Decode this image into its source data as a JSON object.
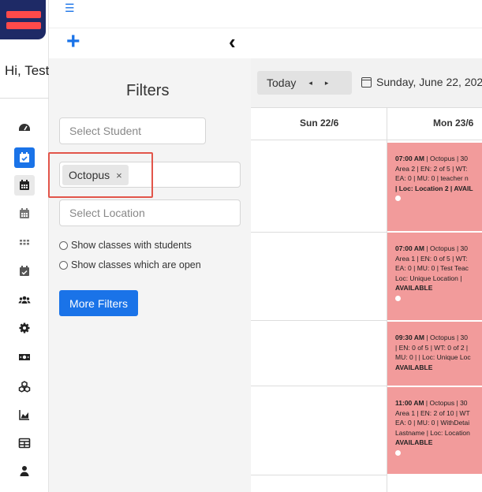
{
  "user": {
    "greeting": "Hi, Test"
  },
  "filters": {
    "title": "Filters",
    "student_placeholder": "Select Student",
    "selected_tag": "Octopus",
    "tag_remove": "×",
    "location_placeholder": "Select Location",
    "option_with_students": "Show classes with students",
    "option_open": "Show classes which are open",
    "more_filters": "More Filters"
  },
  "calendar": {
    "today_label": "Today",
    "prev": "◂",
    "next": "▸",
    "date": "Sunday, June 22, 202",
    "days": [
      "Sun 22/6",
      "Mon 23/6"
    ],
    "events": [
      {
        "time": "07:00 AM",
        "lines": [
          "| Octopus | 30",
          "Area 2 | EN: 2 of 5 | WT:",
          "EA: 0 | MU: 0 | teacher n",
          "| Loc: Location 2 | AVAIL"
        ]
      },
      {
        "time": "07:00 AM",
        "lines": [
          "| Octopus | 30",
          "Area 1 | EN: 0 of 5 | WT:",
          "EA: 0 | MU: 0 | Test Teac",
          "Loc: Unique Location |"
        ],
        "status": "AVAILABLE"
      },
      {
        "time": "09:30 AM",
        "lines": [
          "| Octopus | 30",
          "| EN: 0 of 5 | WT: 0 of 2 |",
          "MU: 0 | | Loc: Unique Loc"
        ],
        "status": "AVAILABLE"
      },
      {
        "time": "11:00 AM",
        "lines": [
          "| Octopus | 30",
          "Area 1 | EN: 2 of 10 | WT",
          "EA: 0 | MU: 0 | WithDetai",
          "Lastname | Loc: Location"
        ],
        "status": "AVAILABLE"
      }
    ]
  },
  "colors": {
    "accent": "#1a73e8",
    "event": "#f29b9b",
    "logo_navy": "#1e2a66",
    "logo_red": "#ff4a4a",
    "highlight": "#e2554a"
  },
  "icons": {
    "top": [
      "hamburger-icon",
      "plus-icon",
      "chevron-left-icon"
    ],
    "rail": [
      "dashboard-icon",
      "calendar-check-icon",
      "calendar-icon",
      "calendar-grid-icon",
      "grid-dots-icon",
      "calendar-tasks-icon",
      "users-icon",
      "gear-icon",
      "money-icon",
      "cubes-icon",
      "chart-area-icon",
      "table-icon",
      "user-icon"
    ]
  }
}
